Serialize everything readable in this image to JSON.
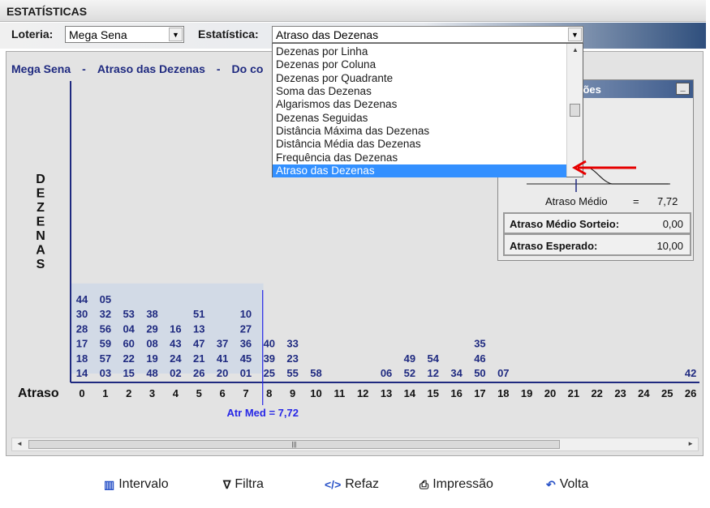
{
  "window": {
    "title": "ESTATÍSTICAS"
  },
  "selector": {
    "loteria_label": "Loteria:",
    "loteria_value": "Mega Sena",
    "estatistica_label": "Estatística:",
    "estatistica_value": "Atraso das Dezenas"
  },
  "dropdown": {
    "items": [
      "Dezenas por Linha",
      "Dezenas por Coluna",
      "Dezenas por Quadrante",
      "Soma das Dezenas",
      "Algarismos das Dezenas",
      "Dezenas Seguidas",
      "Distância Máxima das Dezenas",
      "Distância Média das Dezenas",
      "Frequência das Dezenas",
      "Atraso das Dezenas"
    ],
    "selected": "Atraso das Dezenas"
  },
  "report": {
    "header_loteria": "Mega Sena",
    "header_sep": "-",
    "header_estatistica": "Atraso das Dezenas",
    "header_extra": "Do co"
  },
  "stats": {
    "title_partial": "ações",
    "atraso_medio_label": "Atraso Médio",
    "eq": "=",
    "atraso_medio_value": "7,72",
    "sorteio_label": "Atraso Médio Sorteio:",
    "sorteio_value": "0,00",
    "esperado_label": "Atraso Esperado:",
    "esperado_value": "10,00"
  },
  "chart_data": {
    "type": "table",
    "y_label": "DEZENAS",
    "x_label": "Atraso",
    "x": [
      0,
      1,
      2,
      3,
      4,
      5,
      6,
      7,
      8,
      9,
      10,
      11,
      12,
      13,
      14,
      15,
      16,
      17,
      18,
      19,
      20,
      21,
      22,
      23,
      24,
      25,
      26
    ],
    "columns": [
      {
        "atraso": 0,
        "dezenas": [
          "14",
          "18",
          "17",
          "28",
          "30",
          "44"
        ]
      },
      {
        "atraso": 1,
        "dezenas": [
          "03",
          "57",
          "59",
          "56",
          "32",
          "05"
        ]
      },
      {
        "atraso": 2,
        "dezenas": [
          "15",
          "22",
          "60",
          "04",
          "53"
        ]
      },
      {
        "atraso": 3,
        "dezenas": [
          "48",
          "19",
          "08",
          "29",
          "38"
        ]
      },
      {
        "atraso": 4,
        "dezenas": [
          "02",
          "24",
          "43",
          "16"
        ]
      },
      {
        "atraso": 5,
        "dezenas": [
          "26",
          "21",
          "47",
          "13",
          "51"
        ]
      },
      {
        "atraso": 6,
        "dezenas": [
          "20",
          "41",
          "37"
        ]
      },
      {
        "atraso": 7,
        "dezenas": [
          "01",
          "45",
          "36",
          "27",
          "10"
        ]
      },
      {
        "atraso": 8,
        "dezenas": [
          "25",
          "39",
          "40"
        ]
      },
      {
        "atraso": 9,
        "dezenas": [
          "55",
          "23",
          "33"
        ]
      },
      {
        "atraso": 10,
        "dezenas": [
          "58"
        ]
      },
      {
        "atraso": 11,
        "dezenas": []
      },
      {
        "atraso": 12,
        "dezenas": []
      },
      {
        "atraso": 13,
        "dezenas": [
          "06"
        ]
      },
      {
        "atraso": 14,
        "dezenas": [
          "52",
          "49"
        ]
      },
      {
        "atraso": 15,
        "dezenas": [
          "12",
          "54"
        ]
      },
      {
        "atraso": 16,
        "dezenas": [
          "34"
        ]
      },
      {
        "atraso": 17,
        "dezenas": [
          "50",
          "46",
          "35"
        ]
      },
      {
        "atraso": 18,
        "dezenas": [
          "07"
        ]
      },
      {
        "atraso": 19,
        "dezenas": []
      },
      {
        "atraso": 20,
        "dezenas": []
      },
      {
        "atraso": 21,
        "dezenas": []
      },
      {
        "atraso": 22,
        "dezenas": []
      },
      {
        "atraso": 23,
        "dezenas": []
      },
      {
        "atraso": 24,
        "dezenas": []
      },
      {
        "atraso": 25,
        "dezenas": []
      },
      {
        "atraso": 26,
        "dezenas": [
          "42"
        ]
      }
    ],
    "mean_line": {
      "x": 7.72,
      "label": "Atr Med = 7,72"
    }
  },
  "toolbar": {
    "intervalo": "Intervalo",
    "filtra": "Filtra",
    "refaz": "Refaz",
    "impressao": "Impressão",
    "volta": "Volta"
  },
  "colors": {
    "axis": "#1f2a80",
    "text": "#1f2a80",
    "mean_line": "#2727e6",
    "highlight": "#d2dae6",
    "selected": "#3390ff",
    "arrow": "#e60000"
  }
}
